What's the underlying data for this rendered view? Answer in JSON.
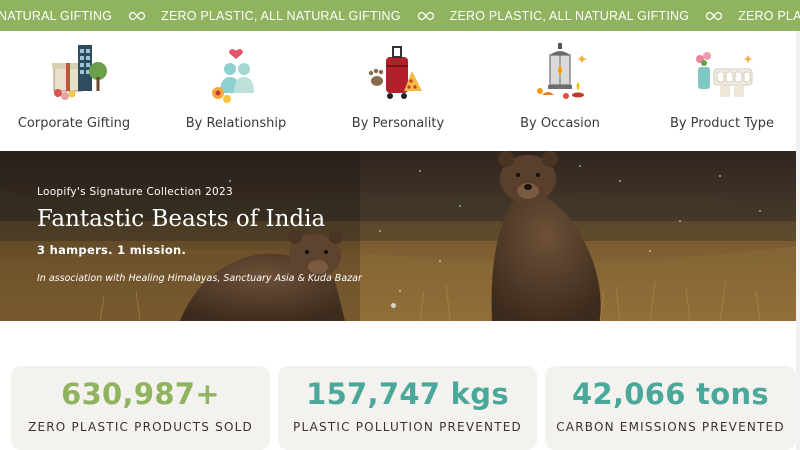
{
  "marquee": {
    "items": [
      "NATURAL GIFTING",
      "ZERO PLASTIC, ALL NATURAL GIFTING",
      "ZERO PLASTIC, ALL NATURAL GIFTING",
      "ZERO PLASTIC, ALL NATURAL GIFTING"
    ],
    "separator_icon": "infinity-icon"
  },
  "categories": [
    {
      "label": "Corporate Gifting",
      "icon": "corporate-gift-icon"
    },
    {
      "label": "By Relationship",
      "icon": "relationship-icon"
    },
    {
      "label": "By Personality",
      "icon": "personality-icon"
    },
    {
      "label": "By Occasion",
      "icon": "occasion-lantern-icon"
    },
    {
      "label": "By Product Type",
      "icon": "product-type-icon"
    }
  ],
  "hero": {
    "eyebrow": "Loopify's Signature Collection 2023",
    "title": "Fantastic Beasts of India",
    "subtitle": "3 hampers. 1 mission.",
    "association": "In association with Healing Himalayas, Sanctuary Asia & Kuda Bazar",
    "slide_count": 1,
    "active_slide": 1
  },
  "stats": [
    {
      "value": "630,987+",
      "label": "ZERO PLASTIC PRODUCTS SOLD",
      "color": "#8fb35f"
    },
    {
      "value": "157,747 kgs",
      "label": "PLASTIC POLLUTION PREVENTED",
      "color": "#4aa89a"
    },
    {
      "value": "42,066 tons",
      "label": "CARBON EMISSIONS PREVENTED",
      "color": "#4aa89a"
    }
  ],
  "colors": {
    "brand_green": "#8fb35f",
    "teal": "#4aa89a",
    "stat_card_bg": "#f4f2ee"
  }
}
